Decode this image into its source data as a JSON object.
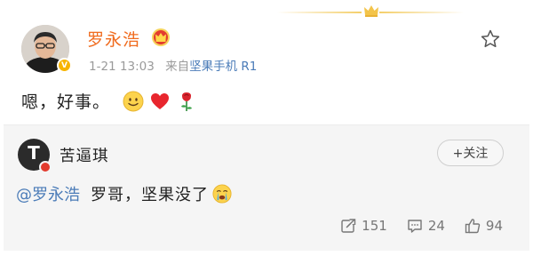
{
  "post": {
    "username": "罗永浩",
    "time": "1-21 13:03",
    "source_prefix": "来自",
    "source": "坚果手机 R1",
    "text": "嗯，好事。"
  },
  "retweet": {
    "username": "苦逼琪",
    "follow_label": "+关注",
    "mention": "@罗永浩",
    "text": "罗哥，坚果没了",
    "actions": {
      "repost_count": "151",
      "comment_count": "24",
      "like_count": "94"
    }
  },
  "colors": {
    "username": "#f06b1e",
    "link": "#4b7cb8",
    "meta": "#9a9a9a",
    "card_bg": "#f5f5f5"
  }
}
